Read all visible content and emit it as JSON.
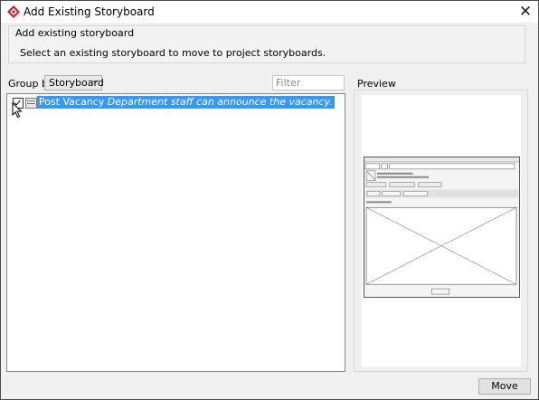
{
  "window": {
    "title": "Add Existing Storyboard",
    "close_glyph": "✕"
  },
  "group_box": {
    "title": "Add existing storyboard",
    "description": "Select an existing storyboard to move to project storyboards."
  },
  "group_by": {
    "label": "Group by:",
    "value": "Storyboard",
    "chevron": "⌵"
  },
  "filter": {
    "placeholder": "Filter",
    "value": ""
  },
  "tree": {
    "items": [
      {
        "checked": true,
        "icon": "storyboard-icon",
        "name": "Post Vacancy",
        "description": "Department staff can announce the vacancy."
      }
    ]
  },
  "preview": {
    "label": "Preview"
  },
  "footer": {
    "move_label": "Move"
  },
  "colors": {
    "selection": "#3399ff",
    "window_bg": "#f0f0f0",
    "app_icon": "#c8202a"
  }
}
